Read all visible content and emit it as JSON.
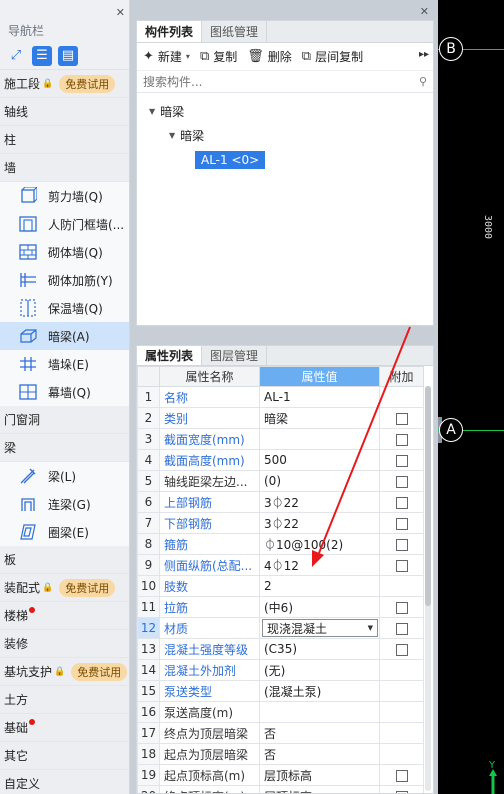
{
  "nav": {
    "title": "导航栏",
    "toolbar": [
      "pin",
      "list",
      "detail-list"
    ],
    "rows": [
      {
        "label": "施工段",
        "lock": true,
        "badge": "免费试用"
      },
      {
        "label": "轴线"
      },
      {
        "label": "柱"
      },
      {
        "label": "墙"
      }
    ],
    "wall_items": [
      {
        "label": "剪力墙(Q)",
        "icon": "shear-wall-icon"
      },
      {
        "label": "人防门框墙(...",
        "icon": "civil-defense-door-wall-icon"
      },
      {
        "label": "砌体墙(Q)",
        "icon": "masonry-wall-icon"
      },
      {
        "label": "砌体加筋(Y)",
        "icon": "masonry-rebar-icon"
      },
      {
        "label": "保温墙(Q)",
        "icon": "insulation-wall-icon"
      },
      {
        "label": "暗梁(A)",
        "icon": "hidden-beam-icon",
        "selected": true
      },
      {
        "label": "墙垛(E)",
        "icon": "wall-pier-icon"
      },
      {
        "label": "幕墙(Q)",
        "icon": "curtain-wall-icon"
      }
    ],
    "rows2": [
      {
        "label": "门窗洞"
      },
      {
        "label": "梁"
      }
    ],
    "beam_items": [
      {
        "label": "梁(L)",
        "icon": "beam-icon"
      },
      {
        "label": "连梁(G)",
        "icon": "coupling-beam-icon"
      },
      {
        "label": "圈梁(E)",
        "icon": "ring-beam-icon"
      }
    ],
    "rows3": [
      {
        "label": "板"
      },
      {
        "label": "装配式",
        "lock": true,
        "badge": "免费试用"
      },
      {
        "label": "楼梯",
        "dot": true
      },
      {
        "label": "装修"
      },
      {
        "label": "基坑支护",
        "lock": true,
        "badge": "免费试用"
      },
      {
        "label": "土方"
      },
      {
        "label": "基础",
        "dot": true
      },
      {
        "label": "其它"
      },
      {
        "label": "自定义"
      }
    ]
  },
  "components": {
    "tabs": [
      "构件列表",
      "图纸管理"
    ],
    "toolbar": {
      "new": "新建",
      "copy": "复制",
      "delete": "删除",
      "floor_copy": "层间复制"
    },
    "search_placeholder": "搜索构件...",
    "tree": {
      "root": "暗梁",
      "child": "暗梁",
      "leaf": "AL-1 <0>"
    }
  },
  "properties": {
    "tabs": [
      "属性列表",
      "图层管理"
    ],
    "headers": {
      "name": "属性名称",
      "value": "属性值",
      "extra": "附加"
    },
    "rows": [
      {
        "n": "1",
        "name": "名称",
        "value": "AL-1",
        "check": false,
        "blue": true
      },
      {
        "n": "2",
        "name": "类别",
        "value": "暗梁",
        "check": true,
        "blue": true
      },
      {
        "n": "3",
        "name": "截面宽度(mm)",
        "value": "",
        "check": true,
        "blue": true
      },
      {
        "n": "4",
        "name": "截面高度(mm)",
        "value": "500",
        "check": true,
        "blue": true
      },
      {
        "n": "5",
        "name": "轴线距梁左边...",
        "value": "(0)",
        "check": true,
        "blue": false
      },
      {
        "n": "6",
        "name": "上部钢筋",
        "value": "3⏀22",
        "check": true,
        "blue": true
      },
      {
        "n": "7",
        "name": "下部钢筋",
        "value": "3⏀22",
        "check": true,
        "blue": true
      },
      {
        "n": "8",
        "name": "箍筋",
        "value": "⏀10@100(2)",
        "check": true,
        "blue": true
      },
      {
        "n": "9",
        "name": "侧面纵筋(总配...",
        "value": "4⏀12",
        "check": true,
        "blue": true
      },
      {
        "n": "10",
        "name": "肢数",
        "value": "2",
        "check": false,
        "blue": true
      },
      {
        "n": "11",
        "name": "拉筋",
        "value": "(中6)",
        "check": true,
        "blue": true
      },
      {
        "n": "12",
        "name": "材质",
        "value": "现浇混凝土",
        "check": true,
        "blue": true,
        "select": true,
        "selected": true
      },
      {
        "n": "13",
        "name": "混凝土强度等级",
        "value": "(C35)",
        "check": true,
        "blue": true
      },
      {
        "n": "14",
        "name": "混凝土外加剂",
        "value": "(无)",
        "check": false,
        "blue": true
      },
      {
        "n": "15",
        "name": "泵送类型",
        "value": "(混凝土泵)",
        "check": false,
        "blue": true
      },
      {
        "n": "16",
        "name": "泵送高度(m)",
        "value": "",
        "check": false,
        "blue": false
      },
      {
        "n": "17",
        "name": "终点为顶层暗梁",
        "value": "否",
        "check": false,
        "blue": false
      },
      {
        "n": "18",
        "name": "起点为顶层暗梁",
        "value": "否",
        "check": false,
        "blue": false
      },
      {
        "n": "19",
        "name": "起点顶标高(m)",
        "value": "层顶标高",
        "check": true,
        "blue": false
      },
      {
        "n": "20",
        "name": "终点顶标高(m)",
        "value": "层顶标高",
        "check": true,
        "blue": false
      }
    ]
  },
  "canvas": {
    "axis_b": "B",
    "axis_a": "A",
    "dimension": "3000",
    "ucs_y": "Y"
  },
  "colors": {
    "accent": "#2f7ce6",
    "annotation_arrow": "#e8191b",
    "axis": "#12c64b"
  }
}
